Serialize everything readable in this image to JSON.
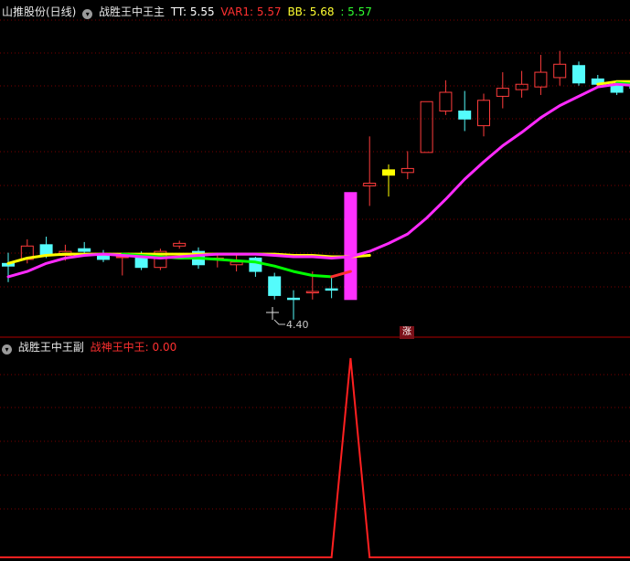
{
  "main_header": {
    "stock": "山推股份(日线)",
    "indicator": "战胜王中王主",
    "tt_label": "TT: 5.55",
    "var1_label": "VAR1: 5.57",
    "bb_label": "BB: 5.68",
    "extra_label": ": 5.57"
  },
  "sub_header": {
    "indicator": "战胜王中王副",
    "value_label": "战神王中王: 0.00"
  },
  "signal_marker": "涨",
  "low_marker": "4.40",
  "colors": {
    "up": "#ff3c3c",
    "down": "#54fcfc",
    "yellow_bar": "#ffff00",
    "magenta_bar": "#ff30ff",
    "magenta_line": "#ff2aff",
    "yellow_line": "#ffff00",
    "green_line": "#00ff00",
    "sub_line": "#ff2020",
    "grid": "#7a0000"
  },
  "chart_data": {
    "type": "candlestick",
    "candles": [
      {
        "o": 4.82,
        "h": 4.9,
        "l": 4.68,
        "c": 4.8
      },
      {
        "o": 4.85,
        "h": 5.0,
        "l": 4.82,
        "c": 4.95
      },
      {
        "o": 4.96,
        "h": 5.02,
        "l": 4.86,
        "c": 4.88
      },
      {
        "o": 4.88,
        "h": 4.96,
        "l": 4.84,
        "c": 4.91
      },
      {
        "o": 4.93,
        "h": 4.98,
        "l": 4.88,
        "c": 4.91
      },
      {
        "o": 4.89,
        "h": 4.92,
        "l": 4.83,
        "c": 4.85
      },
      {
        "o": 4.87,
        "h": 4.88,
        "l": 4.73,
        "c": 4.87
      },
      {
        "o": 4.87,
        "h": 4.91,
        "l": 4.77,
        "c": 4.79
      },
      {
        "o": 4.79,
        "h": 4.93,
        "l": 4.77,
        "c": 4.91
      },
      {
        "o": 4.95,
        "h": 4.99,
        "l": 4.93,
        "c": 4.97
      },
      {
        "o": 4.91,
        "h": 4.94,
        "l": 4.78,
        "c": 4.81
      },
      {
        "o": 4.86,
        "h": 4.9,
        "l": 4.79,
        "c": 4.86
      },
      {
        "o": 4.81,
        "h": 4.88,
        "l": 4.76,
        "c": 4.83
      },
      {
        "o": 4.86,
        "h": 4.87,
        "l": 4.72,
        "c": 4.76
      },
      {
        "o": 4.72,
        "h": 4.75,
        "l": 4.55,
        "c": 4.58
      },
      {
        "o": 4.56,
        "h": 4.62,
        "l": 4.4,
        "c": 4.55
      },
      {
        "o": 4.6,
        "h": 4.76,
        "l": 4.55,
        "c": 4.61
      },
      {
        "o": 4.63,
        "h": 4.73,
        "l": 4.56,
        "c": 4.62
      },
      {
        "o": 4.55,
        "h": 5.35,
        "l": 4.55,
        "c": 5.35
      },
      {
        "o": 5.4,
        "h": 5.77,
        "l": 5.25,
        "c": 5.42
      },
      {
        "o": 5.52,
        "h": 5.56,
        "l": 5.32,
        "c": 5.48
      },
      {
        "o": 5.5,
        "h": 5.66,
        "l": 5.45,
        "c": 5.53
      },
      {
        "o": 5.65,
        "h": 6.03,
        "l": 5.65,
        "c": 6.03
      },
      {
        "o": 5.96,
        "h": 6.19,
        "l": 5.93,
        "c": 6.1
      },
      {
        "o": 5.96,
        "h": 6.11,
        "l": 5.81,
        "c": 5.9
      },
      {
        "o": 5.85,
        "h": 6.09,
        "l": 5.77,
        "c": 6.04
      },
      {
        "o": 6.07,
        "h": 6.25,
        "l": 5.98,
        "c": 6.13
      },
      {
        "o": 6.12,
        "h": 6.26,
        "l": 6.06,
        "c": 6.16
      },
      {
        "o": 6.14,
        "h": 6.38,
        "l": 6.08,
        "c": 6.25
      },
      {
        "o": 6.21,
        "h": 6.41,
        "l": 6.15,
        "c": 6.31
      },
      {
        "o": 6.3,
        "h": 6.33,
        "l": 6.15,
        "c": 6.17
      },
      {
        "o": 6.2,
        "h": 6.23,
        "l": 6.14,
        "c": 6.16
      },
      {
        "o": 6.15,
        "h": 6.19,
        "l": 6.08,
        "c": 6.1
      },
      {
        "o": 6.16,
        "h": 6.2,
        "l": 6.06,
        "c": 6.13
      },
      {
        "o": 6.17,
        "h": 6.22,
        "l": 6.04,
        "c": 6.08
      }
    ],
    "marked_candles": [
      {
        "index": 18,
        "color": "magenta"
      },
      {
        "index": 20,
        "color": "yellow"
      }
    ],
    "ma_line": [
      4.72,
      4.76,
      4.82,
      4.86,
      4.88,
      4.89,
      4.88,
      4.87,
      4.86,
      4.87,
      4.88,
      4.89,
      4.89,
      4.89,
      4.88,
      4.87,
      4.87,
      4.86,
      4.87,
      4.91,
      4.97,
      5.04,
      5.16,
      5.3,
      5.45,
      5.58,
      5.7,
      5.8,
      5.91,
      6.0,
      6.07,
      6.14,
      6.16,
      6.15,
      6.14
    ],
    "segments": [
      {
        "color": "yellow",
        "from": 0,
        "values": [
          4.82,
          4.86,
          4.88,
          4.89,
          4.89,
          4.89,
          4.89,
          4.89,
          4.89,
          4.89,
          4.89,
          4.89,
          4.89,
          4.89,
          4.89,
          4.88,
          4.88,
          4.87,
          4.87,
          4.88
        ]
      },
      {
        "color": "green",
        "from": 6,
        "values": [
          4.89,
          4.88,
          4.87,
          4.86,
          4.86,
          4.85,
          4.84,
          4.83,
          4.8,
          4.76,
          4.73,
          4.72
        ]
      },
      {
        "color": "red",
        "from": 17,
        "values": [
          4.72,
          4.76
        ]
      },
      {
        "color": "yellow",
        "from": 31,
        "values": [
          6.16,
          6.18,
          6.18,
          6.18
        ]
      },
      {
        "color": "green",
        "from": 32,
        "values": [
          6.17,
          6.16,
          6.14
        ]
      }
    ],
    "y_range": [
      4.33,
      6.64
    ],
    "sub_series": [
      0,
      0,
      0,
      0,
      0,
      0,
      0,
      0,
      0,
      0,
      0,
      0,
      0,
      0,
      0,
      0,
      0,
      0,
      1,
      0,
      0,
      0,
      0,
      0,
      0,
      0,
      0,
      0,
      0,
      0,
      0,
      0,
      0,
      0,
      0
    ],
    "sub_range": [
      0,
      1
    ]
  }
}
